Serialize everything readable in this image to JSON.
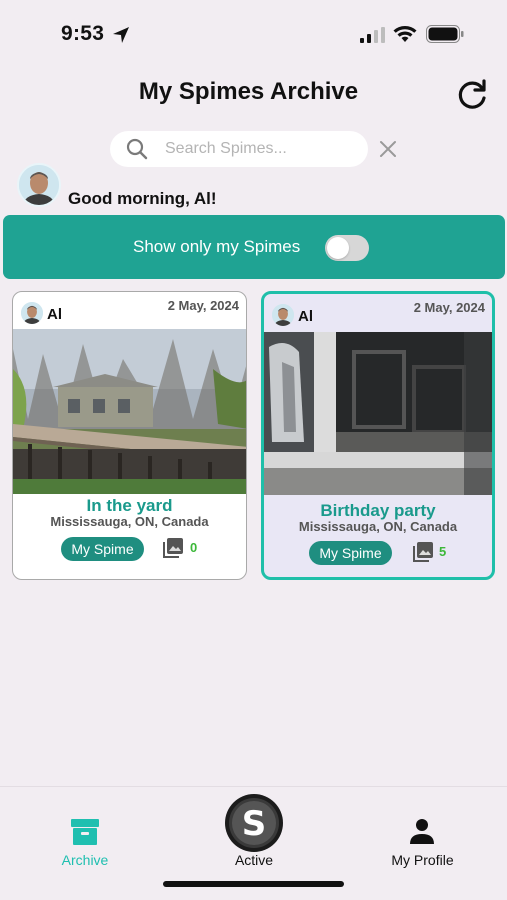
{
  "status_bar": {
    "time": "9:53",
    "icons": [
      "location-arrow-icon",
      "signal-icon",
      "wifi-icon",
      "battery-icon"
    ]
  },
  "header": {
    "title": "My Spimes Archive",
    "refresh_icon": "refresh-icon"
  },
  "search": {
    "placeholder": "Search Spimes...",
    "value": "",
    "icon": "search-icon",
    "clear_icon": "close-icon"
  },
  "greeting": {
    "text": "Good morning, Al!",
    "avatar": "user-avatar"
  },
  "filter": {
    "label": "Show only my Spimes",
    "enabled": false
  },
  "spimes": [
    {
      "owner": "Al",
      "date": "2 May, 2024",
      "title": "In the yard",
      "location": "Mississauga, ON, Canada",
      "my_spime_label": "My Spime",
      "photo_count": "0",
      "selected": false
    },
    {
      "owner": "Al",
      "date": "2 May, 2024",
      "title": "Birthday party",
      "location": "Mississauga, ON, Canada",
      "my_spime_label": "My Spime",
      "photo_count": "5",
      "selected": true
    }
  ],
  "bottom_nav": {
    "items": [
      {
        "label": "Archive",
        "icon": "archive-box-icon",
        "active": true
      },
      {
        "label": "Active",
        "icon": "spime-logo-icon",
        "active": false
      },
      {
        "label": "My Profile",
        "icon": "person-icon",
        "active": false
      }
    ]
  },
  "colors": {
    "accent": "#1fa393",
    "accent_dark": "#1f8e80",
    "selected_border": "#1fbfa9",
    "title_teal": "#1a9a8c",
    "count_green": "#3db83a",
    "background": "#f2edf2"
  }
}
